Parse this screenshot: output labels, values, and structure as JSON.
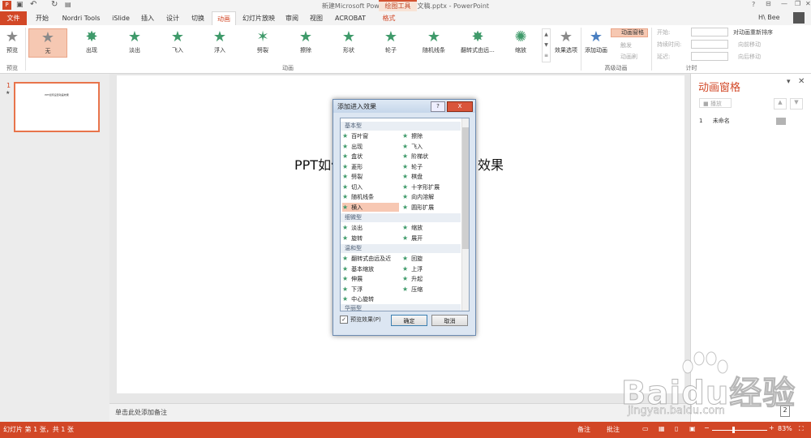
{
  "window": {
    "title": "新建Microsoft PowerPoint 演示文稿.pptx - PowerPoint",
    "user": "H\\ Bee",
    "contextual_group": "绘图工具"
  },
  "tabs": [
    "文件",
    "开始",
    "Nordri Tools",
    "iSlide",
    "插入",
    "设计",
    "切换",
    "动画",
    "幻灯片放映",
    "审阅",
    "视图",
    "ACROBAT",
    "格式"
  ],
  "ribbon": {
    "preview_label": "预览",
    "preview_group": "预览",
    "animations": [
      "无",
      "出现",
      "淡出",
      "飞入",
      "浮入",
      "劈裂",
      "擦除",
      "形状",
      "轮子",
      "随机线条",
      "翻转式由远...",
      "缩放"
    ],
    "effect_options": "效果选项",
    "animation_group": "动画",
    "add_animation": "添加动画",
    "animation_pane_btn": "动画窗格",
    "trigger": "触发",
    "painter": "动画刷",
    "advanced_group": "高级动画",
    "start_label": "开始:",
    "duration_label": "持续时间:",
    "delay_label": "延迟:",
    "timing_group": "计时",
    "reorder_title": "对动画重新排序",
    "move_earlier": "向前移动",
    "move_later": "向后移动"
  },
  "slide_panel": {
    "number": "1",
    "star": "★",
    "thumb_text": "PPT如何设置动画效果"
  },
  "slide": {
    "title_left": "PPT如何",
    "title_right": "效果"
  },
  "notes": {
    "placeholder": "单击此处添加备注"
  },
  "anim_pane": {
    "title": "动画窗格",
    "play_label": "播放",
    "item_index": "1",
    "item_name": "未命名"
  },
  "dialog": {
    "title": "添加进入效果",
    "help": "?",
    "close": "X",
    "categories": [
      "基本型",
      "细微型",
      "温和型",
      "华丽型"
    ],
    "basic_left": [
      "百叶窗",
      "出现",
      "盒状",
      "菱形",
      "劈裂",
      "切入",
      "随机线条",
      "横入"
    ],
    "basic_right": [
      "擦除",
      "飞入",
      "阶梯状",
      "轮子",
      "棋盘",
      "十字形扩展",
      "向内溶解",
      "圆形扩展"
    ],
    "subtle_left": [
      "淡出",
      "旋转"
    ],
    "subtle_right": [
      "缩放",
      "展开"
    ],
    "moderate_left": [
      "翻转式由远及近",
      "基本缩放",
      "伸展",
      "下浮",
      "中心旋转"
    ],
    "moderate_right": [
      "回旋",
      "上浮",
      "升起",
      "压缩"
    ],
    "preview_checkbox": "预览效果(P)",
    "ok": "确定",
    "cancel": "取消"
  },
  "status": {
    "slide_info": "幻灯片 第 1 张，共 1 张",
    "notes_btn": "备注",
    "comments_btn": "批注",
    "zoom": "83%",
    "page_box": "2"
  },
  "watermark": {
    "logo_text": "Baidu经验",
    "url": "jingyan.baidu.com"
  },
  "colors": {
    "accent": "#d24726",
    "star_green": "#3f9a6a",
    "selection": "#f7c8b3"
  }
}
